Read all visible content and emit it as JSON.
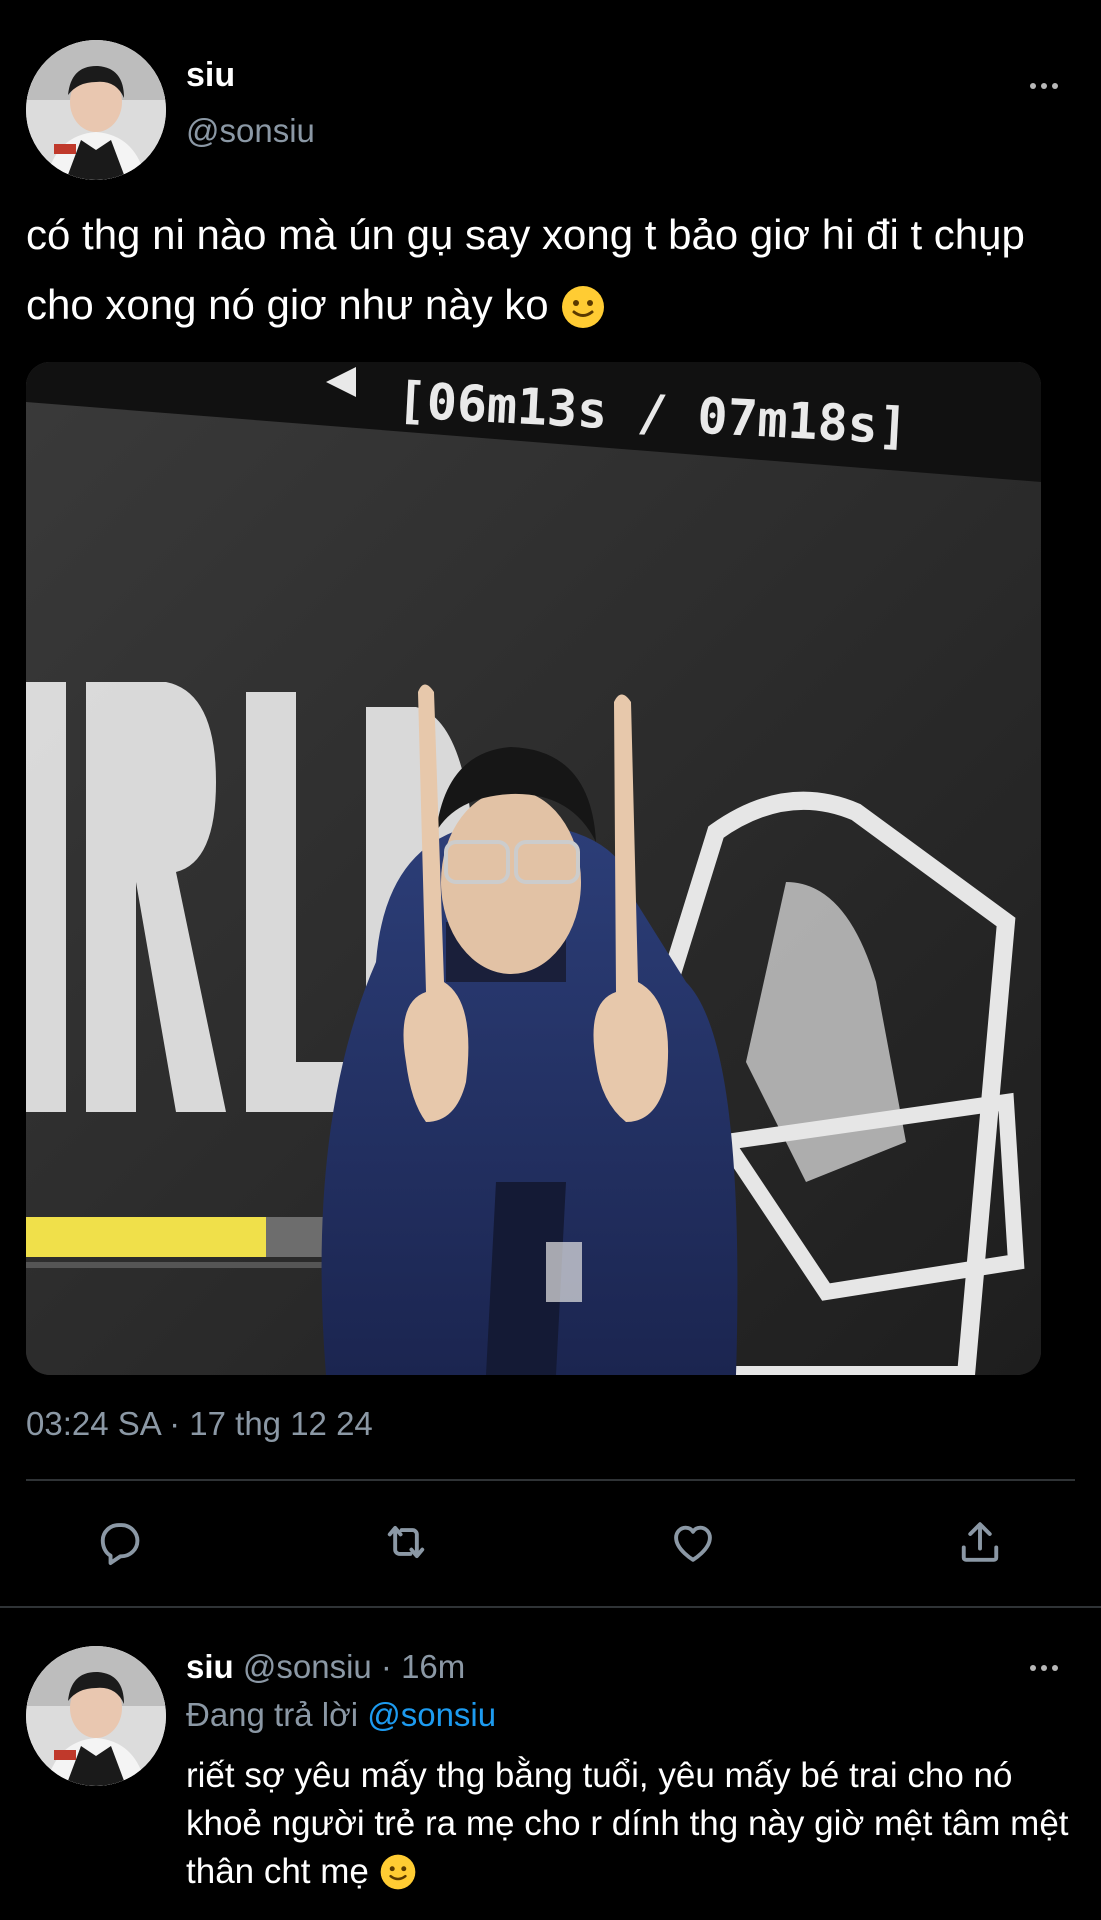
{
  "tweet": {
    "author_name": "siu",
    "author_handle": "@sonsiu",
    "text": "có thg ni nào mà ún gụ say xong t bảo giơ hi đi t chụp cho xong nó giơ như này ko",
    "emoji": "slightly-smiling-face",
    "media": {
      "timer_overlay": "[06m13s / 07m18s]"
    },
    "timestamp": "03:24 SA · 17 thg 12 24"
  },
  "actions": [
    "reply-icon",
    "retweet-icon",
    "like-icon",
    "share-icon"
  ],
  "reply": {
    "author_name": "siu",
    "author_handle": "@sonsiu",
    "age": "· 16m",
    "replying_prefix": "Đang trả lời",
    "replying_to": "@sonsiu",
    "text": "riết sợ yêu mấy thg bằng tuổi, yêu mấy bé trai cho nó khoẻ người trẻ ra mẹ cho r dính thg này giờ mệt tâm mệt thân cht mẹ",
    "emoji": "slightly-smiling-face"
  },
  "colors": {
    "background": "#000000",
    "text": "#ffffff",
    "secondary": "#8b98a5",
    "link": "#1d9bf0",
    "divider": "#2f3336"
  }
}
